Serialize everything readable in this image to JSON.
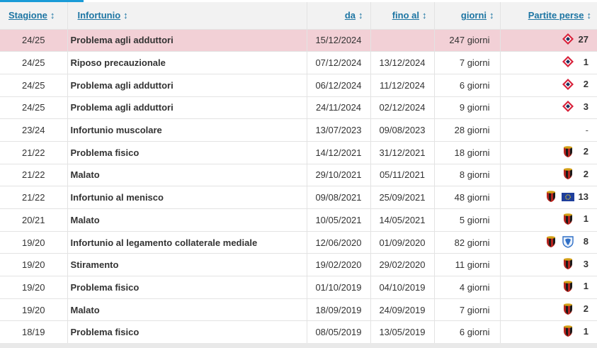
{
  "table": {
    "headers": {
      "season": "Stagione",
      "injury": "Infortunio",
      "from": "da",
      "until": "fino al",
      "days": "giorni",
      "games_missed": "Partite perse"
    },
    "sort_glyph": "↕",
    "rows": [
      {
        "season": "24/25",
        "injury": "Problema agli adduttori",
        "from": "15/12/2024",
        "until": "",
        "days": "247 giorni",
        "clubs": [
          "lille-crest-icon"
        ],
        "games": "27",
        "highlight": true
      },
      {
        "season": "24/25",
        "injury": "Riposo precauzionale",
        "from": "07/12/2024",
        "until": "13/12/2024",
        "days": "7 giorni",
        "clubs": [
          "lille-crest-icon"
        ],
        "games": "1",
        "highlight": false
      },
      {
        "season": "24/25",
        "injury": "Problema agli adduttori",
        "from": "06/12/2024",
        "until": "11/12/2024",
        "days": "6 giorni",
        "clubs": [
          "lille-crest-icon"
        ],
        "games": "2",
        "highlight": false
      },
      {
        "season": "24/25",
        "injury": "Problema agli adduttori",
        "from": "24/11/2024",
        "until": "02/12/2024",
        "days": "9 giorni",
        "clubs": [
          "lille-crest-icon"
        ],
        "games": "3",
        "highlight": false
      },
      {
        "season": "23/24",
        "injury": "Infortunio muscolare",
        "from": "13/07/2023",
        "until": "09/08/2023",
        "days": "28 giorni",
        "clubs": [],
        "games": "-",
        "highlight": false
      },
      {
        "season": "21/22",
        "injury": "Problema fisico",
        "from": "14/12/2021",
        "until": "31/12/2021",
        "days": "18 giorni",
        "clubs": [
          "club-crest-icon"
        ],
        "games": "2",
        "highlight": false
      },
      {
        "season": "21/22",
        "injury": "Malato",
        "from": "29/10/2021",
        "until": "05/11/2021",
        "days": "8 giorni",
        "clubs": [
          "club-crest-icon"
        ],
        "games": "2",
        "highlight": false
      },
      {
        "season": "21/22",
        "injury": "Infortunio al menisco",
        "from": "09/08/2021",
        "until": "25/09/2021",
        "days": "48 giorni",
        "clubs": [
          "club-crest-icon",
          "eu-flag-icon"
        ],
        "games": "13",
        "highlight": false
      },
      {
        "season": "20/21",
        "injury": "Malato",
        "from": "10/05/2021",
        "until": "14/05/2021",
        "days": "5 giorni",
        "clubs": [
          "club-crest-icon"
        ],
        "games": "1",
        "highlight": false
      },
      {
        "season": "19/20",
        "injury": "Infortunio al legamento collaterale mediale",
        "from": "12/06/2020",
        "until": "01/09/2020",
        "days": "82 giorni",
        "clubs": [
          "club-crest-icon",
          "blue-shield-icon"
        ],
        "games": "8",
        "highlight": false
      },
      {
        "season": "19/20",
        "injury": "Stiramento",
        "from": "19/02/2020",
        "until": "29/02/2020",
        "days": "11 giorni",
        "clubs": [
          "club-crest-icon"
        ],
        "games": "3",
        "highlight": false
      },
      {
        "season": "19/20",
        "injury": "Problema fisico",
        "from": "01/10/2019",
        "until": "04/10/2019",
        "days": "4 giorni",
        "clubs": [
          "club-crest-icon"
        ],
        "games": "1",
        "highlight": false
      },
      {
        "season": "19/20",
        "injury": "Malato",
        "from": "18/09/2019",
        "until": "24/09/2019",
        "days": "7 giorni",
        "clubs": [
          "club-crest-icon"
        ],
        "games": "2",
        "highlight": false
      },
      {
        "season": "18/19",
        "injury": "Problema fisico",
        "from": "08/05/2019",
        "until": "13/05/2019",
        "days": "6 giorni",
        "clubs": [
          "club-crest-icon"
        ],
        "games": "1",
        "highlight": false
      }
    ]
  },
  "colors": {
    "header_link": "#1d75a3",
    "highlight_row": "#f2d0d6",
    "accent_bar": "#1a9bd7"
  }
}
